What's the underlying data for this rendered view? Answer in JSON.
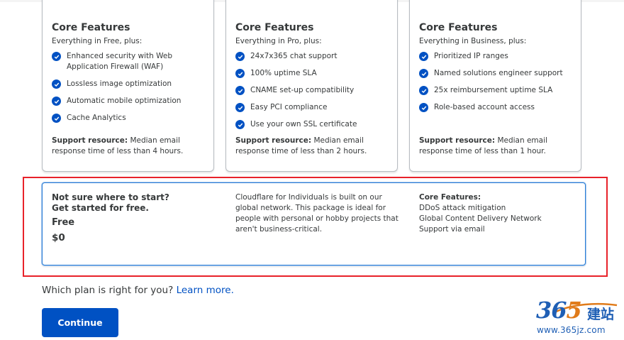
{
  "plans": [
    {
      "heading": "Core Features",
      "intro": "Everything in Free, plus:",
      "features": [
        "Enhanced security with Web Application Firewall (WAF)",
        "Lossless image optimization",
        "Automatic mobile optimization",
        "Cache Analytics"
      ],
      "support_label": "Support resource:",
      "support_text": " Median email response time of less than 4 hours."
    },
    {
      "heading": "Core Features",
      "intro": "Everything in Pro, plus:",
      "features": [
        "24x7x365 chat support",
        "100% uptime SLA",
        "CNAME set-up compatibility",
        "Easy PCI compliance",
        "Use your own SSL certificate"
      ],
      "support_label": "Support resource:",
      "support_text": " Median email response time of less than 2 hours."
    },
    {
      "heading": "Core Features",
      "intro": "Everything in Business, plus:",
      "features": [
        "Prioritized IP ranges",
        "Named solutions engineer support",
        "25x reimbursement uptime SLA",
        "Role-based account access"
      ],
      "support_label": "Support resource:",
      "support_text": " Median email response time of less than 1 hour."
    }
  ],
  "free_plan": {
    "question_line1": "Not sure where to start?",
    "question_line2": "Get started for free.",
    "name": "Free",
    "price": "$0",
    "description": "Cloudflare for Individuals is built on our global network. This package is ideal for people with personal or hobby projects that aren't business-critical.",
    "core_title": "Core Features:",
    "core_items": [
      "DDoS attack mitigation",
      "Global Content Delivery Network",
      "Support via email"
    ]
  },
  "help": {
    "text": "Which plan is right for you? ",
    "link": "Learn more."
  },
  "continue_label": "Continue",
  "watermark": {
    "digits_a": "36",
    "digits_b": "5",
    "chinese": "建站",
    "url": "www.365jz.com"
  },
  "icons": {
    "feature_check": "check-circle-icon"
  },
  "colors": {
    "accent": "#0051c3",
    "highlight_border": "#e8222a"
  }
}
